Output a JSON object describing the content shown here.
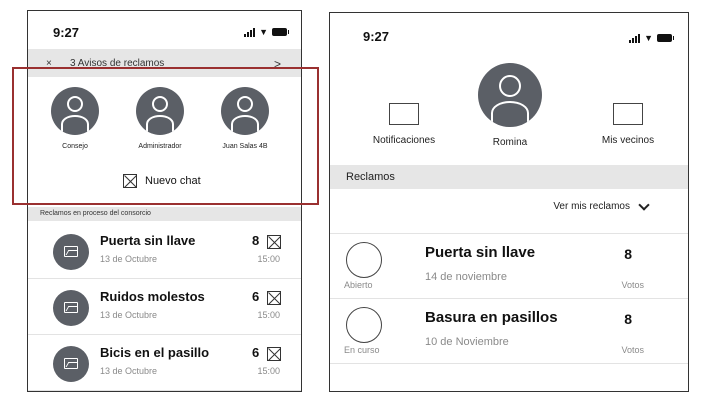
{
  "left_screen": {
    "status": {
      "time": "9:27"
    },
    "notification_bar": {
      "close": "×",
      "text": "3 Avisos de reclamos",
      "arrow": ">"
    },
    "contacts": [
      {
        "name": "Consejo"
      },
      {
        "name": "Administrador"
      },
      {
        "name": "Juan Salas 4B"
      }
    ],
    "new_chat_label": "Nuevo chat",
    "section_title": "Reclamos en proceso del consorcio",
    "claims": [
      {
        "title": "Puerta sin llave",
        "date": "13 de Octubre",
        "count": "8",
        "time": "15:00"
      },
      {
        "title": "Ruidos molestos",
        "date": "13 de Octubre",
        "count": "6",
        "time": "15:00"
      },
      {
        "title": "Bicis en el pasillo",
        "date": "13 de Octubre",
        "count": "6",
        "time": "15:00"
      }
    ]
  },
  "right_screen": {
    "status": {
      "time": "9:27"
    },
    "nav": {
      "notifications": "Notificaciones",
      "profile_name": "Romina",
      "neighbors": "Mis vecinos"
    },
    "section_title": "Reclamos",
    "dropdown_label": "Ver mis reclamos",
    "claims": [
      {
        "title": "Puerta sin llave",
        "date": "14 de noviembre",
        "count": "8",
        "votes_label": "Votos",
        "status": "Abierto"
      },
      {
        "title": "Basura en pasillos",
        "date": "10 de Noviembre",
        "count": "8",
        "votes_label": "Votos",
        "status": "En curso"
      }
    ]
  },
  "colors": {
    "highlight": "#9a3030",
    "avatar": "#5b5f66",
    "section_bg": "#e6e6e6"
  }
}
